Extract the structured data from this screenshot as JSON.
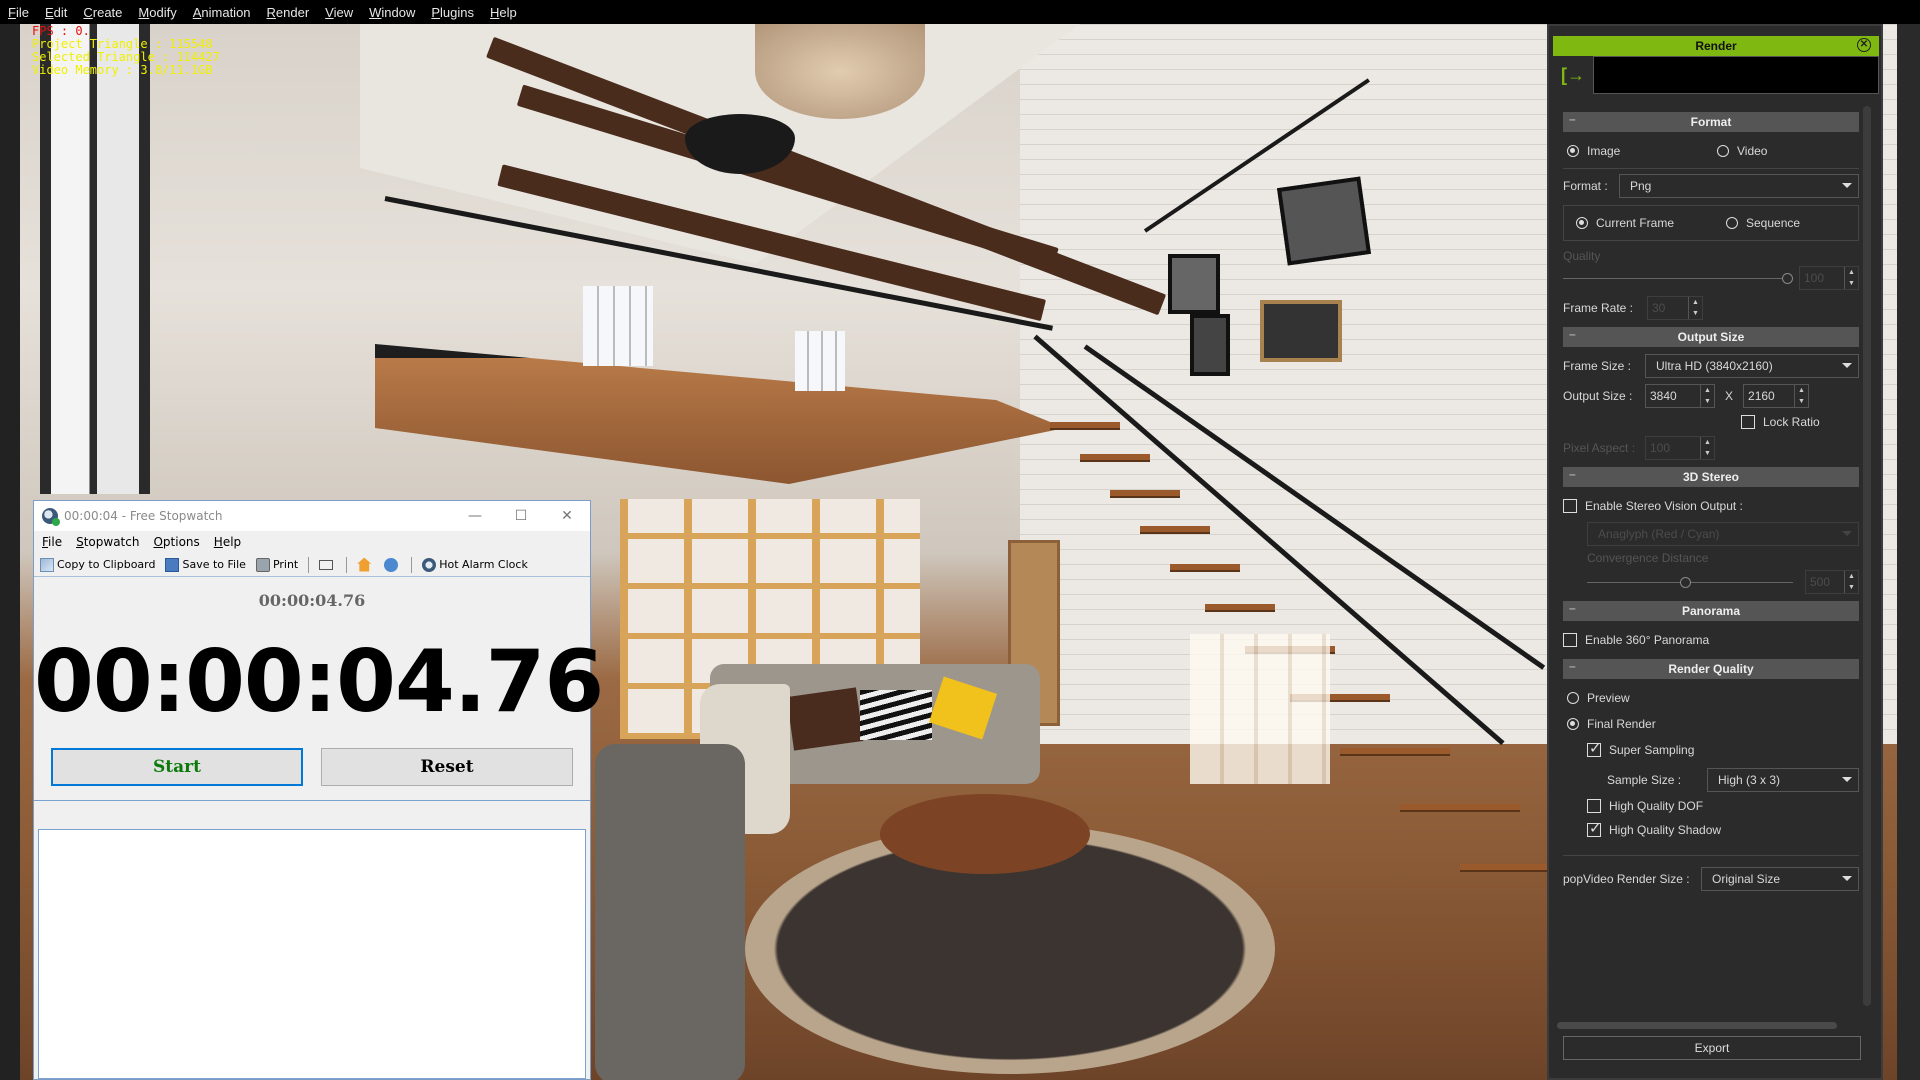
{
  "menubar": {
    "items": [
      "File",
      "Edit",
      "Create",
      "Modify",
      "Animation",
      "Render",
      "View",
      "Window",
      "Plugins",
      "Help"
    ]
  },
  "stats": {
    "fps": "FPS : 0.",
    "project_triangle": "Project Triangle : 115548",
    "selected_triangle": "Selected Triangle : 114427",
    "video_memory": "Video Memory : 3.8/11.1GB"
  },
  "stopwatch": {
    "title": "00:00:04 - Free Stopwatch",
    "menu": [
      "File",
      "Stopwatch",
      "Options",
      "Help"
    ],
    "toolbar": {
      "copy": "Copy to Clipboard",
      "save": "Save to File",
      "print": "Print",
      "alarm": "Hot Alarm Clock"
    },
    "small_time": "00:00:04.76",
    "big_time": "00:00:04.76",
    "start_label": "Start",
    "reset_label": "Reset",
    "colors": {
      "start_text": "#0b7a0b",
      "focus_border": "#0078d7"
    }
  },
  "render_panel": {
    "title": "Render",
    "accent_color": "#80b812",
    "format": {
      "header": "Format",
      "image_label": "Image",
      "video_label": "Video",
      "selected": "Image",
      "format_label": "Format :",
      "format_value": "Png",
      "current_frame_label": "Current Frame",
      "sequence_label": "Sequence",
      "frame_selected": "Current Frame",
      "quality_label": "Quality",
      "quality_value": "100",
      "quality_slider": 1.0,
      "frame_rate_label": "Frame Rate :",
      "frame_rate_value": "30"
    },
    "output_size": {
      "header": "Output Size",
      "frame_size_label": "Frame Size :",
      "frame_size_value": "Ultra HD (3840x2160)",
      "output_size_label": "Output Size :",
      "width": "3840",
      "x_label": "X",
      "height": "2160",
      "lock_ratio_label": "Lock Ratio",
      "lock_ratio": false,
      "pixel_aspect_label": "Pixel Aspect :",
      "pixel_aspect_value": "100"
    },
    "stereo": {
      "header": "3D Stereo",
      "enable_label": "Enable Stereo Vision Output :",
      "enabled": false,
      "mode_value": "Anaglyph (Red / Cyan)",
      "convergence_label": "Convergence Distance",
      "convergence_value": "500",
      "convergence_slider": 0.5
    },
    "panorama": {
      "header": "Panorama",
      "enable_label": "Enable 360° Panorama",
      "enabled": false
    },
    "quality": {
      "header": "Render Quality",
      "preview_label": "Preview",
      "final_label": "Final Render",
      "selected": "Final Render",
      "super_sampling_label": "Super Sampling",
      "super_sampling": true,
      "sample_size_label": "Sample Size :",
      "sample_size_value": "High (3 x 3)",
      "dof_label": "High Quality DOF",
      "dof": false,
      "shadow_label": "High Quality Shadow",
      "shadow": true
    },
    "popvideo_label": "popVideo Render Size :",
    "popvideo_value": "Original Size",
    "export_label": "Export"
  }
}
